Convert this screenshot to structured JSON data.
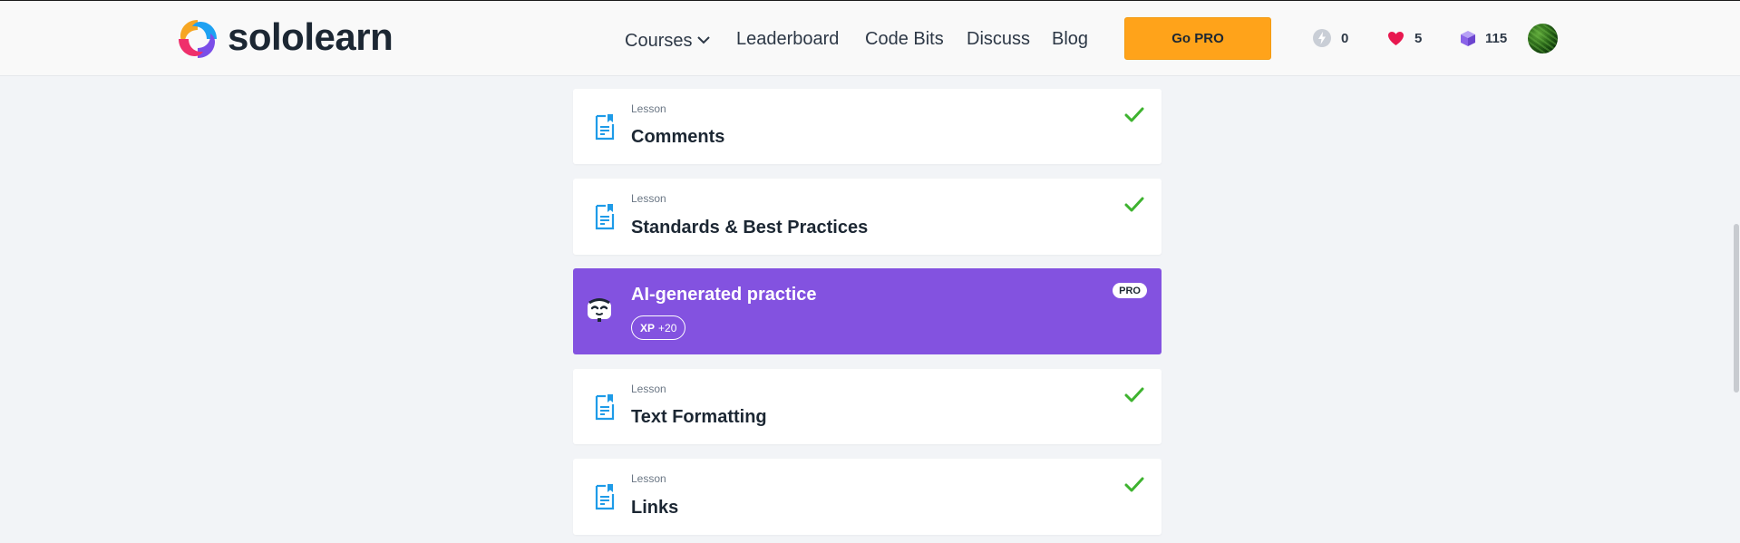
{
  "header": {
    "logo_text": "sololearn",
    "nav": {
      "courses": "Courses",
      "leaderboard": "Leaderboard",
      "code_bits": "Code Bits",
      "discuss": "Discuss",
      "blog": "Blog"
    },
    "go_pro": "Go PRO",
    "stats": {
      "streak": "0",
      "hearts": "5",
      "bits": "115"
    },
    "colors": {
      "go_pro_bg": "#ffa31a",
      "heart": "#e8184f",
      "bits": "#8a63e8"
    }
  },
  "lessons": [
    {
      "kind": "Lesson",
      "title": "Comments",
      "completed": true
    },
    {
      "kind": "Lesson",
      "title": "Standards & Best Practices",
      "completed": true
    },
    {
      "kind": "Lesson",
      "title": "Text Formatting",
      "completed": true
    },
    {
      "kind": "Lesson",
      "title": "Links",
      "completed": true
    }
  ],
  "ai_practice": {
    "title": "AI-generated practice",
    "xp_label": "XP",
    "xp_value": "+20",
    "badge": "PRO",
    "color": "#8352e0"
  },
  "icons": {
    "lesson": "document-icon",
    "completed": "check-icon",
    "streak": "lightning-icon",
    "hearts": "heart-icon",
    "bits": "cube-icon",
    "ai": "robot-face-icon"
  }
}
